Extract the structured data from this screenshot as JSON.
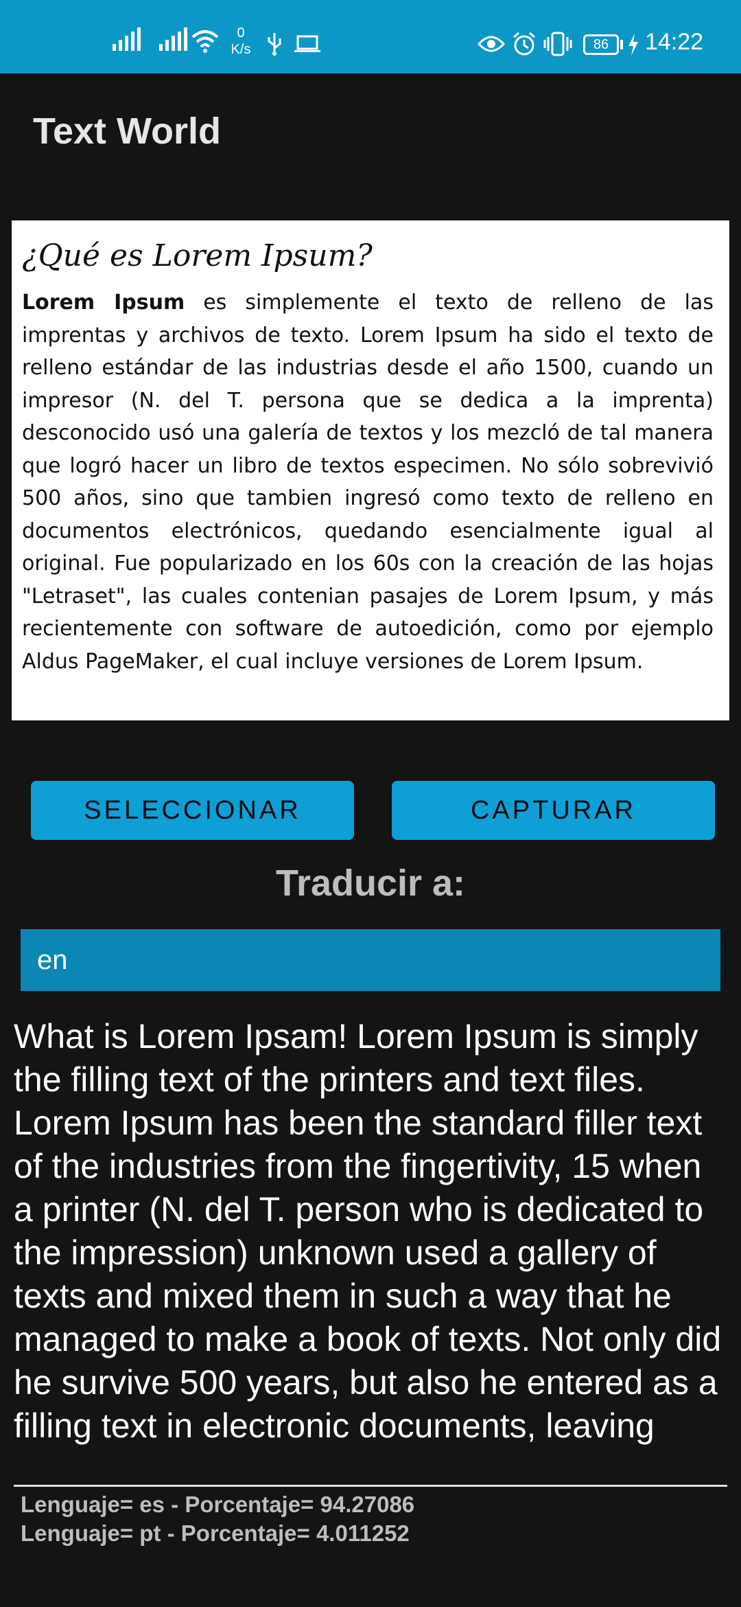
{
  "status_bar": {
    "netspeed_value": "0",
    "netspeed_unit": "K/s",
    "battery": "86",
    "time": "14:22",
    "icons": [
      "signal-icon",
      "signal-icon",
      "wifi-icon",
      "usb-icon",
      "laptop-icon",
      "eye-icon",
      "alarm-icon",
      "vibrate-icon",
      "battery-icon",
      "charging-icon"
    ]
  },
  "app": {
    "title": "Text World"
  },
  "image_panel": {
    "heading": "¿Qué es Lorem Ipsum?",
    "bold_lead": "Lorem Ipsum",
    "body": " es simplemente el texto de relleno de las imprentas y archivos de texto. Lorem Ipsum ha sido el texto de relleno estándar de las industrias desde el año 1500, cuando un impresor (N. del T. persona que se dedica a la imprenta) desconocido usó una galería de textos y los mezcló de tal manera que logró hacer un libro de textos especimen. No sólo sobrevivió 500 años, sino que tambien ingresó como texto de relleno en documentos electrónicos, quedando esencialmente igual al original. Fue popularizado en los 60s con la creación de las hojas \"Letraset\", las cuales contenian pasajes de Lorem Ipsum, y más recientemente con software de autoedición, como por ejemplo Aldus PageMaker, el cual incluye versiones de Lorem Ipsum."
  },
  "buttons": {
    "select_label": "SELECCIONAR",
    "capture_label": "CAPTURAR"
  },
  "translate": {
    "label": "Traducir a:",
    "language_value": "en"
  },
  "translation": {
    "text": "What is Lorem Ipsam! Lorem Ipsum is simply the filling text of the printers and text files. Lorem Ipsum has been the standard filler text of the industries from the fingertivity, 15 when a printer (N. del T. person who is dedicated to the impression) unknown used a gallery of texts and mixed them in such a way that he managed to make a book of texts. Not only did he survive 500 years, but also he entered as a filling text in electronic documents, leaving"
  },
  "results": [
    "Lenguaje= es - Porcentaje= 94.27086",
    "Lenguaje= pt - Porcentaje= 4.011252"
  ],
  "colors": {
    "accent": "#0d97c6",
    "button": "#0d9fd6",
    "field": "#0b86b5",
    "background": "#141414"
  }
}
